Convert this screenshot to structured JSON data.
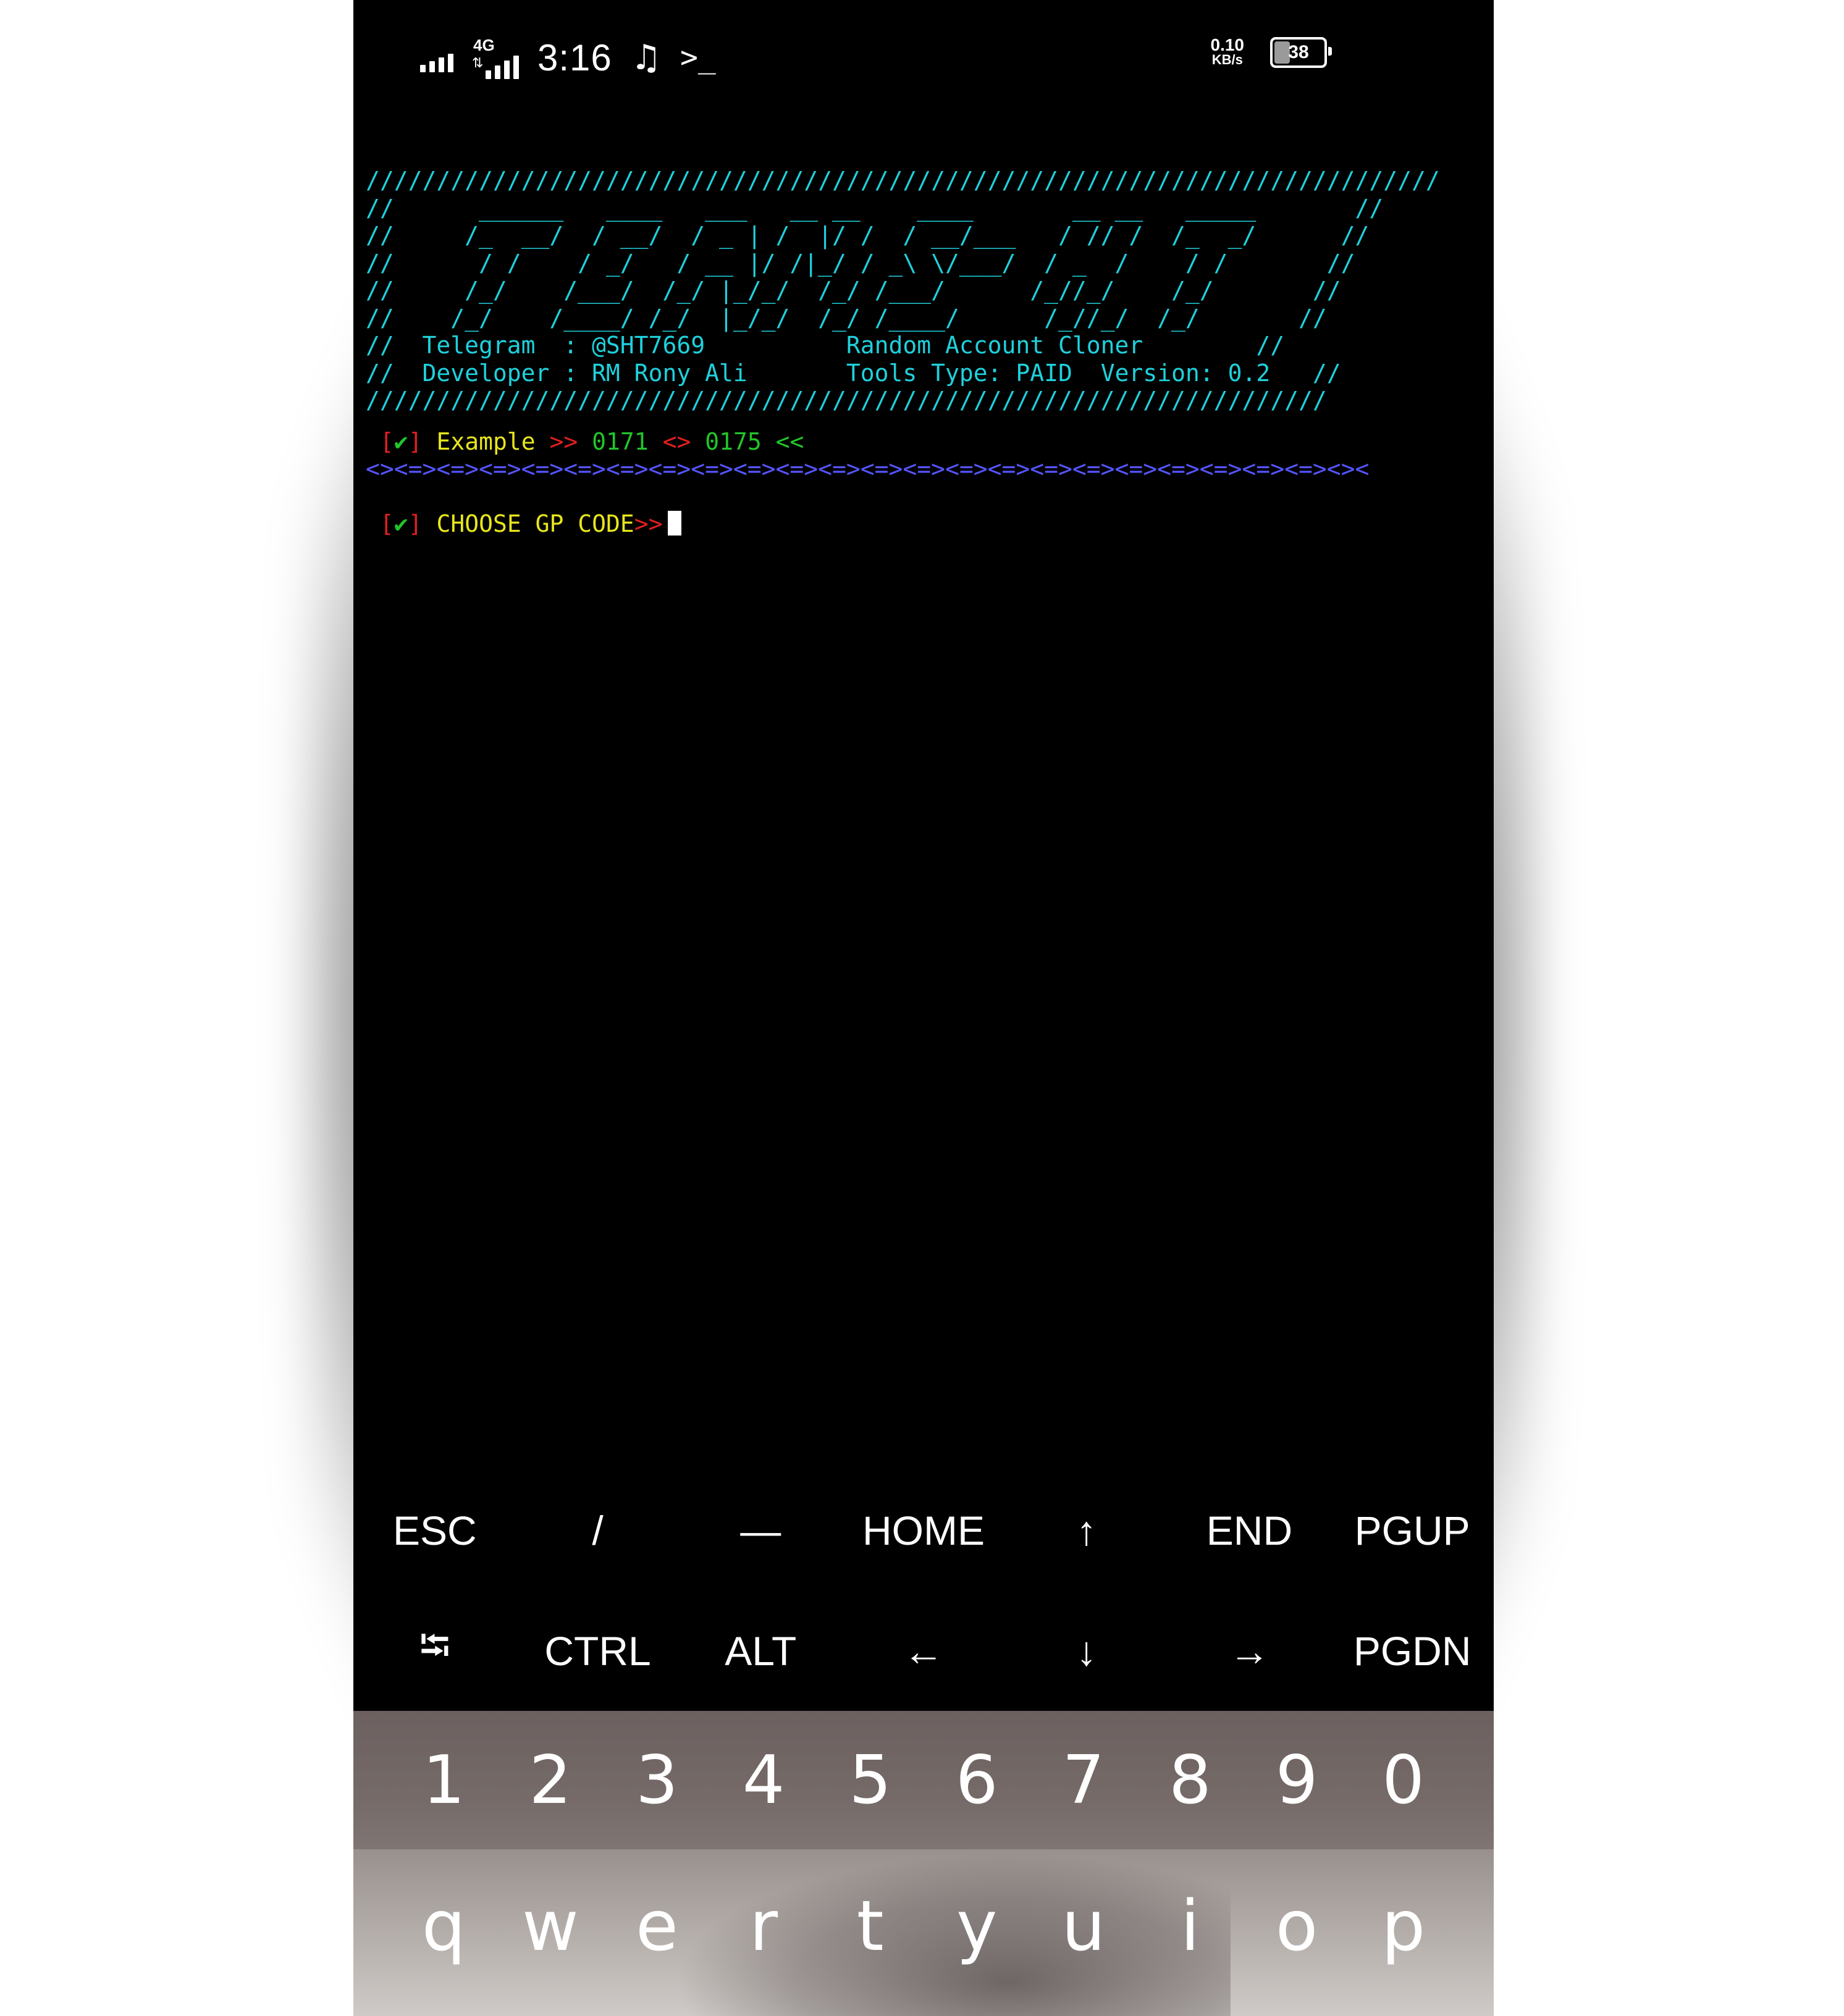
{
  "status_bar": {
    "network_type": "4G",
    "time": "3:16",
    "music_icon": "music-note-icon",
    "terminal_icon": "terminal-prompt-icon",
    "speed_value": "0.10",
    "speed_unit": "KB/s",
    "battery_level": "38"
  },
  "terminal": {
    "banner_lines": [
      "////////////////////////////////////////////////////////////////////////////",
      "//      ______   ____   ___   __ __    ____       __ __   _____       //",
      "//     /_  __/  / __/  / _ | /  |/ /  / __/___   / // /  /_  _/      //",
      "//      / /    / _/   / __ |/ /|_/ / _\\ \\/___/  / _  /    / /       //",
      "//     /_/    /___/  /_/ |_/_/  /_/ /___/      /_//_/    /_/       //",
      "//    /_/    /____/ /_/  |_/_/  /_/ /____/      /_//_/  /_/       //"
    ],
    "telegram_label": "Telegram  ",
    "telegram_value": ": @SHT7669",
    "tool_name": "Random Account Cloner",
    "developer_label": "Developer ",
    "developer_value": ": RM Rony Ali",
    "tools_type": "Tools Type: PAID",
    "version": "Version: 0.2",
    "banner_bottom": "////////////////////////////////////////////////////////////////////",
    "example_check": "✔",
    "example_label": "Example",
    "example_arrow_right": ">>",
    "example_code_1": "0171",
    "example_sep": "<>",
    "example_code_2": "0175",
    "example_arrow_left": "<<",
    "divider": "<><=><=><=><=><=><=><=><=><=><=><=><=><=><=><=><=><=><=><=><=><=><=><><",
    "prompt_check": "✔",
    "prompt_label": "CHOOSE GP CODE",
    "prompt_arrow": ">>"
  },
  "extra_keys": {
    "row1": [
      "ESC",
      "/",
      "—",
      "HOME",
      "↑",
      "END",
      "PGUP"
    ],
    "row2": [
      "⭾",
      "CTRL",
      "ALT",
      "←",
      "↓",
      "→",
      "PGDN"
    ]
  },
  "keyboard": {
    "numbers": [
      "1",
      "2",
      "3",
      "4",
      "5",
      "6",
      "7",
      "8",
      "9",
      "0"
    ],
    "letters": [
      "q",
      "w",
      "e",
      "r",
      "t",
      "y",
      "u",
      "i",
      "o",
      "p"
    ]
  },
  "colors": {
    "terminal_bg": "#000000",
    "banner_cyan": "#1fd1dc",
    "accent_red": "#e01f1f",
    "accent_green": "#22c52a",
    "accent_yellow": "#e8e61c",
    "divider_blue": "#5555ff"
  }
}
